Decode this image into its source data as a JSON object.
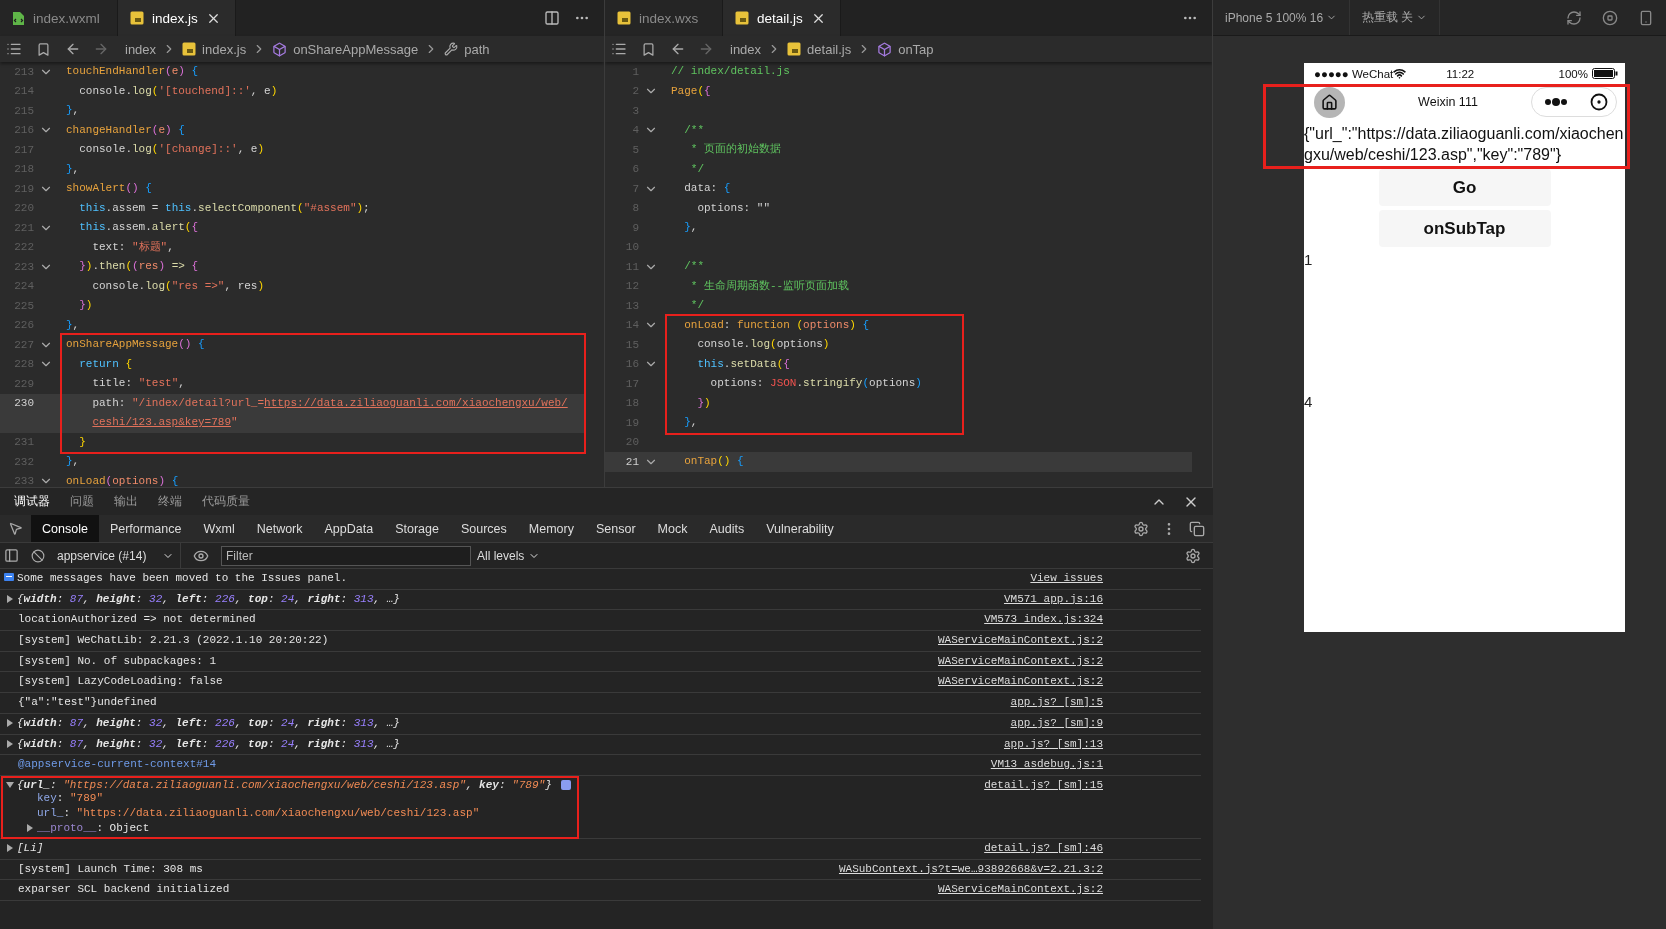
{
  "editors": [
    {
      "tabs": [
        {
          "label": "index.wxml",
          "selected": false,
          "closable": false
        },
        {
          "label": "index.js",
          "selected": true,
          "closable": true
        }
      ],
      "breadcrumb": [
        "index",
        "index.js",
        "onShareAppMessage",
        "path"
      ],
      "sections": [
        {
          "boxed": false,
          "lines": [
            {
              "number": "213",
              "fold": true,
              "current": false,
              "tokens": [
                {
                  "kind": "fn",
                  "text": "touchEndHandler"
                },
                {
                  "kind": "p2",
                  "text": "("
                },
                {
                  "kind": "param",
                  "text": "e"
                },
                {
                  "kind": "p2",
                  "text": ") "
                },
                {
                  "kind": "p3",
                  "text": "{"
                }
              ]
            },
            {
              "number": "214",
              "fold": false,
              "current": false,
              "tokens": [
                {
                  "kind": "plain",
                  "text": "  console."
                },
                {
                  "kind": "method",
                  "text": "log"
                },
                {
                  "kind": "p1",
                  "text": "("
                },
                {
                  "kind": "str",
                  "text": "'[touchend]::'"
                },
                {
                  "kind": "plain",
                  "text": ", e"
                },
                {
                  "kind": "p1",
                  "text": ")"
                }
              ]
            },
            {
              "number": "215",
              "fold": false,
              "current": false,
              "tokens": [
                {
                  "kind": "p3",
                  "text": "}"
                },
                {
                  "kind": "plain",
                  "text": ","
                }
              ]
            },
            {
              "number": "216",
              "fold": true,
              "current": false,
              "tokens": [
                {
                  "kind": "fn",
                  "text": "changeHandler"
                },
                {
                  "kind": "p2",
                  "text": "("
                },
                {
                  "kind": "param",
                  "text": "e"
                },
                {
                  "kind": "p2",
                  "text": ") "
                },
                {
                  "kind": "p3",
                  "text": "{"
                }
              ]
            },
            {
              "number": "217",
              "fold": false,
              "current": false,
              "tokens": [
                {
                  "kind": "plain",
                  "text": "  console."
                },
                {
                  "kind": "method",
                  "text": "log"
                },
                {
                  "kind": "p1",
                  "text": "("
                },
                {
                  "kind": "str",
                  "text": "'[change]::'"
                },
                {
                  "kind": "plain",
                  "text": ", e"
                },
                {
                  "kind": "p1",
                  "text": ")"
                }
              ]
            },
            {
              "number": "218",
              "fold": false,
              "current": false,
              "tokens": [
                {
                  "kind": "p3",
                  "text": "}"
                },
                {
                  "kind": "plain",
                  "text": ","
                }
              ]
            },
            {
              "number": "219",
              "fold": true,
              "current": false,
              "tokens": [
                {
                  "kind": "fn",
                  "text": "showAlert"
                },
                {
                  "kind": "p2",
                  "text": "() "
                },
                {
                  "kind": "p3",
                  "text": "{"
                }
              ]
            },
            {
              "number": "220",
              "fold": false,
              "current": false,
              "tokens": [
                {
                  "kind": "kw",
                  "text": "  this"
                },
                {
                  "kind": "plain",
                  "text": ".assem = "
                },
                {
                  "kind": "kw",
                  "text": "this"
                },
                {
                  "kind": "plain",
                  "text": "."
                },
                {
                  "kind": "method",
                  "text": "selectComponent"
                },
                {
                  "kind": "p1",
                  "text": "("
                },
                {
                  "kind": "str",
                  "text": "\"#assem\""
                },
                {
                  "kind": "p1",
                  "text": ")"
                },
                {
                  "kind": "plain",
                  "text": ";"
                }
              ]
            },
            {
              "number": "221",
              "fold": true,
              "current": false,
              "tokens": [
                {
                  "kind": "kw",
                  "text": "  this"
                },
                {
                  "kind": "plain",
                  "text": ".assem."
                },
                {
                  "kind": "method",
                  "text": "alert"
                },
                {
                  "kind": "p1",
                  "text": "("
                },
                {
                  "kind": "p2",
                  "text": "{"
                }
              ]
            },
            {
              "number": "222",
              "fold": false,
              "current": false,
              "tokens": [
                {
                  "kind": "plain",
                  "text": "    text: "
                },
                {
                  "kind": "str",
                  "text": "\"标题\""
                },
                {
                  "kind": "plain",
                  "text": ","
                }
              ]
            },
            {
              "number": "223",
              "fold": true,
              "current": false,
              "tokens": [
                {
                  "kind": "p2",
                  "text": "  }"
                },
                {
                  "kind": "p1",
                  "text": ")"
                },
                {
                  "kind": "plain",
                  "text": "."
                },
                {
                  "kind": "method",
                  "text": "then"
                },
                {
                  "kind": "p1",
                  "text": "("
                },
                {
                  "kind": "p2",
                  "text": "("
                },
                {
                  "kind": "param",
                  "text": "res"
                },
                {
                  "kind": "p2",
                  "text": ") "
                },
                {
                  "kind": "method",
                  "text": "=> "
                },
                {
                  "kind": "p2",
                  "text": "{"
                }
              ]
            },
            {
              "number": "224",
              "fold": false,
              "current": false,
              "tokens": [
                {
                  "kind": "plain",
                  "text": "    console."
                },
                {
                  "kind": "method",
                  "text": "log"
                },
                {
                  "kind": "p1",
                  "text": "("
                },
                {
                  "kind": "str",
                  "text": "\"res =>\""
                },
                {
                  "kind": "plain",
                  "text": ", res"
                },
                {
                  "kind": "p1",
                  "text": ")"
                }
              ]
            },
            {
              "number": "225",
              "fold": false,
              "current": false,
              "tokens": [
                {
                  "kind": "p2",
                  "text": "  }"
                },
                {
                  "kind": "p1",
                  "text": ")"
                }
              ]
            },
            {
              "number": "226",
              "fold": false,
              "current": false,
              "tokens": [
                {
                  "kind": "p3",
                  "text": "}"
                },
                {
                  "kind": "plain",
                  "text": ","
                }
              ]
            }
          ]
        },
        {
          "boxed": true,
          "lines": [
            {
              "number": "227",
              "fold": true,
              "current": false,
              "tokens": [
                {
                  "kind": "fn",
                  "text": "onShareAppMessage"
                },
                {
                  "kind": "p2",
                  "text": "() "
                },
                {
                  "kind": "p3",
                  "text": "{"
                }
              ]
            },
            {
              "number": "228",
              "fold": true,
              "current": false,
              "tokens": [
                {
                  "kind": "kw",
                  "text": "  return "
                },
                {
                  "kind": "p1",
                  "text": "{"
                }
              ]
            },
            {
              "number": "229",
              "fold": false,
              "current": false,
              "tokens": [
                {
                  "kind": "plain",
                  "text": "    title: "
                },
                {
                  "kind": "str",
                  "text": "\"test\""
                },
                {
                  "kind": "plain",
                  "text": ","
                }
              ]
            },
            {
              "number": "230",
              "fold": false,
              "current": true,
              "tokens": [
                {
                  "kind": "plain",
                  "text": "    path: "
                },
                {
                  "kind": "str",
                  "text": "\"/index/detail?url_="
                },
                {
                  "kind": "url",
                  "text": "https://data.ziliaoguanli.com/xiaochengxu/web/"
                }
              ],
              "continuation": [
                {
                  "kind": "url",
                  "text": "ceshi/123.asp&key=789"
                },
                {
                  "kind": "str",
                  "text": "\""
                }
              ]
            },
            {
              "number": "231",
              "fold": false,
              "current": false,
              "tokens": [
                {
                  "kind": "p1",
                  "text": "  }"
                }
              ]
            }
          ]
        },
        {
          "boxed": false,
          "lines": [
            {
              "number": "232",
              "fold": false,
              "current": false,
              "tokens": [
                {
                  "kind": "p3",
                  "text": "}"
                },
                {
                  "kind": "plain",
                  "text": ","
                }
              ]
            },
            {
              "number": "233",
              "fold": true,
              "current": false,
              "tokens": [
                {
                  "kind": "fn",
                  "text": "onLoad"
                },
                {
                  "kind": "p2",
                  "text": "("
                },
                {
                  "kind": "param",
                  "text": "options"
                },
                {
                  "kind": "p2",
                  "text": ") "
                },
                {
                  "kind": "p3",
                  "text": "{"
                }
              ]
            }
          ]
        }
      ]
    },
    {
      "tabs": [
        {
          "label": "index.wxs",
          "selected": false,
          "closable": false
        },
        {
          "label": "detail.js",
          "selected": true,
          "closable": true
        }
      ],
      "breadcrumb": [
        "index",
        "detail.js",
        "onTap"
      ],
      "sections": [
        {
          "boxed": false,
          "lines": [
            {
              "number": "1",
              "fold": false,
              "current": false,
              "tokens": [
                {
                  "kind": "comment",
                  "text": "// index/detail.js"
                }
              ]
            },
            {
              "number": "2",
              "fold": true,
              "current": false,
              "tokens": [
                {
                  "kind": "fn",
                  "text": "Page"
                },
                {
                  "kind": "p1",
                  "text": "("
                },
                {
                  "kind": "p2",
                  "text": "{"
                }
              ]
            },
            {
              "number": "3",
              "fold": false,
              "current": false
            },
            {
              "number": "4",
              "fold": true,
              "current": false,
              "tokens": [
                {
                  "kind": "comment",
                  "text": "  /**"
                }
              ]
            },
            {
              "number": "5",
              "fold": false,
              "current": false,
              "tokens": [
                {
                  "kind": "comment",
                  "text": "   * 页面的初始数据"
                }
              ]
            },
            {
              "number": "6",
              "fold": false,
              "current": false,
              "tokens": [
                {
                  "kind": "comment",
                  "text": "   */"
                }
              ]
            },
            {
              "number": "7",
              "fold": true,
              "current": false,
              "tokens": [
                {
                  "kind": "plain",
                  "text": "  data: "
                },
                {
                  "kind": "p3",
                  "text": "{"
                }
              ]
            },
            {
              "number": "8",
              "fold": false,
              "current": false,
              "tokens": [
                {
                  "kind": "plain",
                  "text": "    options: \"\""
                }
              ]
            },
            {
              "number": "9",
              "fold": false,
              "current": false,
              "tokens": [
                {
                  "kind": "p3",
                  "text": "  }"
                },
                {
                  "kind": "plain",
                  "text": ","
                }
              ]
            },
            {
              "number": "10",
              "fold": false,
              "current": false
            },
            {
              "number": "11",
              "fold": true,
              "current": false,
              "tokens": [
                {
                  "kind": "comment",
                  "text": "  /**"
                }
              ]
            },
            {
              "number": "12",
              "fold": false,
              "current": false,
              "tokens": [
                {
                  "kind": "comment",
                  "text": "   * 生命周期函数--监听页面加载"
                }
              ]
            },
            {
              "number": "13",
              "fold": false,
              "current": false,
              "tokens": [
                {
                  "kind": "comment",
                  "text": "   */"
                }
              ]
            }
          ]
        },
        {
          "boxed": true,
          "lines": [
            {
              "number": "14",
              "fold": true,
              "current": false,
              "tokens": [
                {
                  "kind": "fn",
                  "text": "  onLoad"
                },
                {
                  "kind": "plain",
                  "text": ": "
                },
                {
                  "kind": "fn",
                  "text": "function "
                },
                {
                  "kind": "p1",
                  "text": "("
                },
                {
                  "kind": "param",
                  "text": "options"
                },
                {
                  "kind": "p1",
                  "text": ") "
                },
                {
                  "kind": "p3",
                  "text": "{"
                }
              ]
            },
            {
              "number": "15",
              "fold": false,
              "current": false,
              "tokens": [
                {
                  "kind": "plain",
                  "text": "    console."
                },
                {
                  "kind": "method",
                  "text": "log"
                },
                {
                  "kind": "p1",
                  "text": "("
                },
                {
                  "kind": "plain",
                  "text": "options"
                },
                {
                  "kind": "p1",
                  "text": ")"
                }
              ]
            },
            {
              "number": "16",
              "fold": true,
              "current": false,
              "tokens": [
                {
                  "kind": "kw",
                  "text": "    this"
                },
                {
                  "kind": "plain",
                  "text": "."
                },
                {
                  "kind": "method",
                  "text": "setData"
                },
                {
                  "kind": "p1",
                  "text": "("
                },
                {
                  "kind": "p2",
                  "text": "{"
                }
              ]
            },
            {
              "number": "17",
              "fold": false,
              "current": false,
              "tokens": [
                {
                  "kind": "plain",
                  "text": "      options: "
                },
                {
                  "kind": "json",
                  "text": "JSON"
                },
                {
                  "kind": "plain",
                  "text": "."
                },
                {
                  "kind": "method",
                  "text": "stringify"
                },
                {
                  "kind": "p3",
                  "text": "("
                },
                {
                  "kind": "plain",
                  "text": "options"
                },
                {
                  "kind": "p3",
                  "text": ")"
                }
              ]
            },
            {
              "number": "18",
              "fold": false,
              "current": false,
              "tokens": [
                {
                  "kind": "p2",
                  "text": "    }"
                },
                {
                  "kind": "p1",
                  "text": ")"
                }
              ]
            },
            {
              "number": "19",
              "fold": false,
              "current": false,
              "tokens": [
                {
                  "kind": "p3",
                  "text": "  }"
                },
                {
                  "kind": "plain",
                  "text": ","
                }
              ]
            }
          ]
        },
        {
          "boxed": false,
          "lines": [
            {
              "number": "20",
              "fold": false,
              "current": false
            },
            {
              "number": "21",
              "fold": true,
              "current": true,
              "tokens": [
                {
                  "kind": "fn",
                  "text": "  onTap"
                },
                {
                  "kind": "p1",
                  "text": "() "
                },
                {
                  "kind": "p3",
                  "text": "{"
                }
              ]
            }
          ]
        }
      ]
    }
  ],
  "simulator": {
    "device": "iPhone 5 100% 16",
    "hot_reload": "热重载 关",
    "highlighted": true,
    "status_bar": {
      "carrier": "●●●●● WeChat",
      "time": "11:22",
      "battery": "100%"
    },
    "nav_title": "Weixin 111",
    "content_text": "{\"url_\":\"https://data.ziliaoguanli.com/xiaochengxu/web/ceshi/123.asp\",\"key\":\"789\"}",
    "buttons": [
      "Go",
      "onSubTap"
    ],
    "numbers": [
      "1",
      "4"
    ]
  },
  "panel": {
    "tabs": [
      {
        "label": "调试器",
        "selected": true
      },
      {
        "label": "问题",
        "selected": false
      },
      {
        "label": "输出",
        "selected": false
      },
      {
        "label": "终端",
        "selected": false
      },
      {
        "label": "代码质量",
        "selected": false
      }
    ],
    "devtools_tabs": [
      {
        "label": "Console",
        "selected": true
      },
      {
        "label": "Performance",
        "selected": false
      },
      {
        "label": "Wxml",
        "selected": false
      },
      {
        "label": "Network",
        "selected": false
      },
      {
        "label": "AppData",
        "selected": false
      },
      {
        "label": "Storage",
        "selected": false
      },
      {
        "label": "Sources",
        "selected": false
      },
      {
        "label": "Memory",
        "selected": false
      },
      {
        "label": "Sensor",
        "selected": false
      },
      {
        "label": "Mock",
        "selected": false
      },
      {
        "label": "Audits",
        "selected": false
      },
      {
        "label": "Vulnerability",
        "selected": false
      }
    ],
    "context": "appservice (#14)",
    "filter_placeholder": "Filter",
    "levels": "All levels",
    "console": [
      {
        "kind": "info",
        "text": "Some messages have been moved to the Issues panel.",
        "source": "View issues"
      },
      {
        "kind": "object",
        "expanded": false,
        "boxed": false,
        "tokens": [
          {
            "kind": "punct",
            "text": "{"
          },
          {
            "kind": "key",
            "text": "width"
          },
          {
            "kind": "punct",
            "text": ": "
          },
          {
            "kind": "number",
            "text": "87"
          },
          {
            "kind": "punct",
            "text": ", "
          },
          {
            "kind": "key",
            "text": "height"
          },
          {
            "kind": "punct",
            "text": ": "
          },
          {
            "kind": "number",
            "text": "32"
          },
          {
            "kind": "punct",
            "text": ", "
          },
          {
            "kind": "key",
            "text": "left"
          },
          {
            "kind": "punct",
            "text": ": "
          },
          {
            "kind": "number",
            "text": "226"
          },
          {
            "kind": "punct",
            "text": ", "
          },
          {
            "kind": "key",
            "text": "top"
          },
          {
            "kind": "punct",
            "text": ": "
          },
          {
            "kind": "number",
            "text": "24"
          },
          {
            "kind": "punct",
            "text": ", "
          },
          {
            "kind": "key",
            "text": "right"
          },
          {
            "kind": "punct",
            "text": ": "
          },
          {
            "kind": "number",
            "text": "313"
          },
          {
            "kind": "punct",
            "text": ", …}"
          }
        ],
        "source": "VM571 app.js:16"
      },
      {
        "kind": "text",
        "text": "locationAuthorized => not determined",
        "source": "VM573 index.js:324"
      },
      {
        "kind": "text",
        "text": "[system] WeChatLib: 2.21.3 (2022.1.10 20:20:22)",
        "source": "WAServiceMainContext.js:2"
      },
      {
        "kind": "text",
        "text": "[system] No. of subpackages: 1",
        "source": "WAServiceMainContext.js:2"
      },
      {
        "kind": "text",
        "text": "[system] LazyCodeLoading: false",
        "source": "WAServiceMainContext.js:2"
      },
      {
        "kind": "text",
        "text": "{\"a\":\"test\"}undefined",
        "source": "app.js? [sm]:5"
      },
      {
        "kind": "object",
        "expanded": false,
        "boxed": false,
        "tokens": [
          {
            "kind": "punct",
            "text": "{"
          },
          {
            "kind": "key",
            "text": "width"
          },
          {
            "kind": "punct",
            "text": ": "
          },
          {
            "kind": "number",
            "text": "87"
          },
          {
            "kind": "punct",
            "text": ", "
          },
          {
            "kind": "key",
            "text": "height"
          },
          {
            "kind": "punct",
            "text": ": "
          },
          {
            "kind": "number",
            "text": "32"
          },
          {
            "kind": "punct",
            "text": ", "
          },
          {
            "kind": "key",
            "text": "left"
          },
          {
            "kind": "punct",
            "text": ": "
          },
          {
            "kind": "number",
            "text": "226"
          },
          {
            "kind": "punct",
            "text": ", "
          },
          {
            "kind": "key",
            "text": "top"
          },
          {
            "kind": "punct",
            "text": ": "
          },
          {
            "kind": "number",
            "text": "24"
          },
          {
            "kind": "punct",
            "text": ", "
          },
          {
            "kind": "key",
            "text": "right"
          },
          {
            "kind": "punct",
            "text": ": "
          },
          {
            "kind": "number",
            "text": "313"
          },
          {
            "kind": "punct",
            "text": ", …}"
          }
        ],
        "source": "app.js? [sm]:9"
      },
      {
        "kind": "object",
        "expanded": false,
        "boxed": false,
        "tokens": [
          {
            "kind": "punct",
            "text": "{"
          },
          {
            "kind": "key",
            "text": "width"
          },
          {
            "kind": "punct",
            "text": ": "
          },
          {
            "kind": "number",
            "text": "87"
          },
          {
            "kind": "punct",
            "text": ", "
          },
          {
            "kind": "key",
            "text": "height"
          },
          {
            "kind": "punct",
            "text": ": "
          },
          {
            "kind": "number",
            "text": "32"
          },
          {
            "kind": "punct",
            "text": ", "
          },
          {
            "kind": "key",
            "text": "left"
          },
          {
            "kind": "punct",
            "text": ": "
          },
          {
            "kind": "number",
            "text": "226"
          },
          {
            "kind": "punct",
            "text": ", "
          },
          {
            "kind": "key",
            "text": "top"
          },
          {
            "kind": "punct",
            "text": ": "
          },
          {
            "kind": "number",
            "text": "24"
          },
          {
            "kind": "punct",
            "text": ", "
          },
          {
            "kind": "key",
            "text": "right"
          },
          {
            "kind": "punct",
            "text": ": "
          },
          {
            "kind": "number",
            "text": "313"
          },
          {
            "kind": "punct",
            "text": ", …}"
          }
        ],
        "source": "app.js? [sm]:13"
      },
      {
        "kind": "context",
        "text": "@appservice-current-context#14",
        "source": "VM13 asdebug.js:1"
      },
      {
        "kind": "object",
        "expanded": true,
        "boxed": true,
        "tokens": [
          {
            "kind": "punct",
            "text": "{"
          },
          {
            "kind": "key",
            "text": "url_"
          },
          {
            "kind": "punct",
            "text": ": "
          },
          {
            "kind": "string",
            "text": "\"https://data.ziliaoguanli.com/xiaochengxu/web/ceshi/123.asp\""
          },
          {
            "kind": "punct",
            "text": ", "
          },
          {
            "kind": "key",
            "text": "key"
          },
          {
            "kind": "punct",
            "text": ": "
          },
          {
            "kind": "string",
            "text": "\"789\""
          },
          {
            "kind": "punct",
            "text": "}"
          }
        ],
        "children": [
          {
            "kind": "leaf",
            "tokens": [
              {
                "kind": "prop",
                "text": "key"
              },
              {
                "kind": "plain",
                "text": ": "
              },
              {
                "kind": "string",
                "text": "\"789\""
              }
            ]
          },
          {
            "kind": "leaf",
            "tokens": [
              {
                "kind": "prop",
                "text": "url_"
              },
              {
                "kind": "plain",
                "text": ": "
              },
              {
                "kind": "string",
                "text": "\"https://data.ziliaoguanli.com/xiaochengxu/web/ceshi/123.asp\""
              }
            ]
          },
          {
            "kind": "branch",
            "tokens": [
              {
                "kind": "dim",
                "text": "__proto__"
              },
              {
                "kind": "plain",
                "text": ": Object"
              }
            ]
          }
        ],
        "source": "detail.js? [sm]:15"
      },
      {
        "kind": "object",
        "expanded": false,
        "boxed": false,
        "tokens": [
          {
            "kind": "punct",
            "text": "[Li]"
          }
        ],
        "source": "detail.js? [sm]:46"
      },
      {
        "kind": "text",
        "text": "[system] Launch Time: 308 ms",
        "source": "WASubContext.js?t=we…93892668&v=2.21.3:2"
      },
      {
        "kind": "text",
        "text": "exparser SCL backend initialized",
        "source": "WAServiceMainContext.js:2"
      }
    ]
  }
}
